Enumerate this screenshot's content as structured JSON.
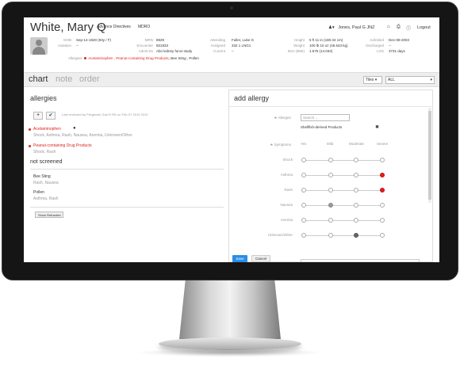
{
  "patient": {
    "name": "White, Mary Q",
    "links": [
      "Advance Directives",
      "MDRO"
    ],
    "fields": [
      {
        "label": "DOB",
        "value": "Sep-14-1920 (93y / F)"
      },
      {
        "label": "Isolation",
        "value": "--"
      },
      {
        "label": "MRN",
        "value": "8929"
      },
      {
        "label": "Encounter",
        "value": "501933"
      },
      {
        "label": "Admit Dx",
        "value": "Abn kidney funct study"
      },
      {
        "label": "Attending",
        "value": "Fuller, Luke G"
      },
      {
        "label": "Assigned",
        "value": "332 1 LNG1"
      },
      {
        "label": "Current",
        "value": "--"
      },
      {
        "label": "Height",
        "value": "5 ft 11 in (180.34 cm)"
      },
      {
        "label": "Weight",
        "value": "100 lb 10 oz (45.643 kg)"
      },
      {
        "label": "BSA (BMI)",
        "value": "1.575 (14.034)"
      },
      {
        "label": "Admitted",
        "value": "Dec-08-2003"
      },
      {
        "label": "Discharged",
        "value": "--"
      },
      {
        "label": "LOS",
        "value": "3731 days"
      }
    ],
    "allergies_label": "Allergies",
    "allergies_red": "Acetaminophen , Peanut-containing Drug Products",
    "allergies_other": ", Bee Sting , Pollen"
  },
  "user": {
    "name": "Jones, Paul G JNZ",
    "logout": "Logout"
  },
  "tabs": [
    {
      "label": "chart",
      "active": true
    },
    {
      "label": "note",
      "active": false
    },
    {
      "label": "order",
      "active": false
    }
  ],
  "controls": {
    "tiles": "Tiles",
    "filter": "ALL"
  },
  "allergies_panel": {
    "title": "allergies",
    "add_icon": "+",
    "check_icon": "✔",
    "reviewed": "Last reviewed by Fitzgerald, Sue R RD on Feb-07-2014 0210",
    "items": [
      {
        "name": "Acetaminophen",
        "reactions": "Shock, Asthma, Rash, Nausea, Anemia, Unknown/Other"
      },
      {
        "name": "Peanut-containing Drug Products",
        "reactions": "Shock, Rash"
      }
    ],
    "not_screened_title": "not screened",
    "not_screened": [
      {
        "name": "Bee Sting",
        "reactions": "Rash, Nausea"
      },
      {
        "name": "Pollen",
        "reactions": "Asthma, Rash"
      }
    ],
    "show_retracted": "Show Retracted"
  },
  "add_allergy": {
    "title": "add allergy",
    "allergen_label": "Allergen",
    "search_placeholder": "Search ...",
    "selected_allergen": "Shellfish-derived Products",
    "remove_icon": "✖",
    "symptoms_label": "Symptoms",
    "severity_columns": [
      "Yes",
      "Mild",
      "Moderate",
      "Severe"
    ],
    "symptoms": [
      {
        "name": "Shock",
        "level": "none"
      },
      {
        "name": "Asthma",
        "level": "Severe"
      },
      {
        "name": "Rash",
        "level": "Severe"
      },
      {
        "name": "Nausea",
        "level": "Mild"
      },
      {
        "name": "Anemia",
        "level": "none"
      },
      {
        "name": "Unknown/Other",
        "level": "Moderate"
      }
    ],
    "save": "Save",
    "cancel": "Cancel"
  },
  "colors": {
    "accent": "#2a8ee5",
    "alert": "#e21d1d"
  }
}
